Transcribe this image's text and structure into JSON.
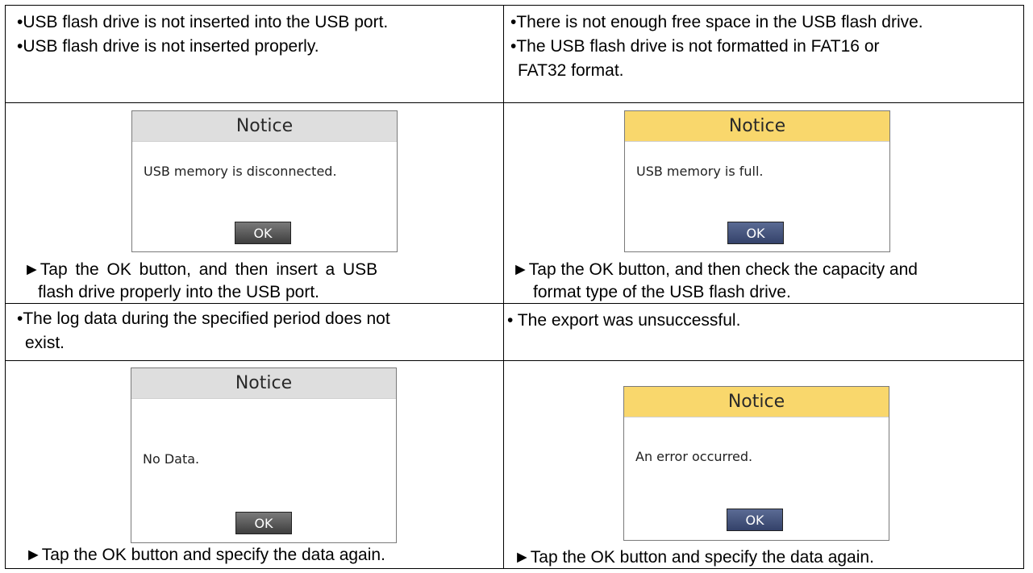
{
  "cells": [
    {
      "conditions": [
        "•USB flash drive is not inserted into the USB port.",
        "•USB flash drive is not inserted properly."
      ],
      "dialog": {
        "title": "Notice",
        "message": "USB memory is disconnected.",
        "ok_label": "OK",
        "header_color": "#dedede"
      },
      "action": [
        "►Tap the OK button, and then insert a USB",
        "flash drive properly into the USB port."
      ]
    },
    {
      "conditions": [
        "•There is not enough free space in the USB flash drive.",
        "•The USB flash drive is not formatted in FAT16 or",
        "FAT32 format."
      ],
      "dialog": {
        "title": "Notice",
        "message": "USB memory is full.",
        "ok_label": "OK",
        "header_color": "#f9d76c"
      },
      "action": [
        "►Tap the OK button, and then check the capacity and",
        "format type of the USB flash drive."
      ]
    },
    {
      "conditions": [
        "•The log data during the specified period does not",
        "exist."
      ],
      "dialog": {
        "title": "Notice",
        "message": "No Data.",
        "ok_label": "OK",
        "header_color": "#dedede"
      },
      "action": [
        "►Tap the OK button and specify the data again."
      ]
    },
    {
      "conditions": [
        "• The export was unsuccessful."
      ],
      "dialog": {
        "title": "Notice",
        "message": "An error occurred.",
        "ok_label": "OK",
        "header_color": "#f9d76c"
      },
      "action": [
        "►Tap the OK button and specify the data again."
      ]
    }
  ]
}
